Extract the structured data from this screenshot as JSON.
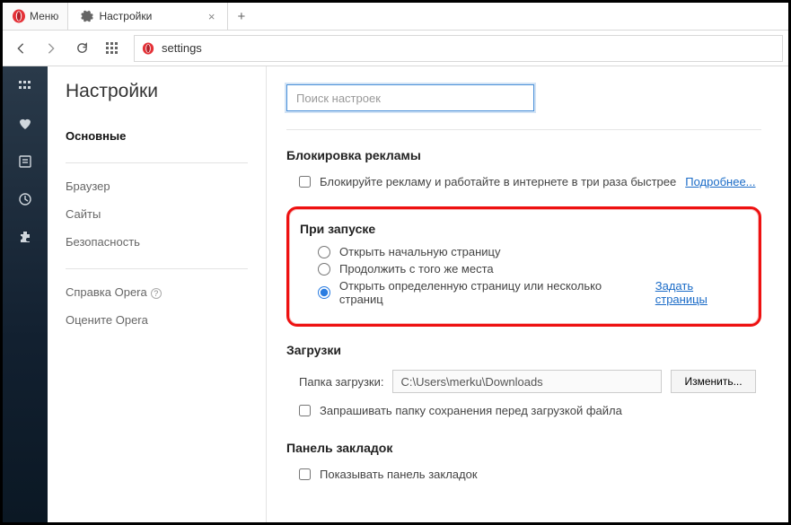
{
  "chrome": {
    "menu_label": "Меню",
    "tab_title": "Настройки",
    "address": "settings"
  },
  "sidebar": {
    "title": "Настройки",
    "items": [
      {
        "label": "Основные",
        "active": true
      },
      {
        "label": "Браузер",
        "active": false
      },
      {
        "label": "Сайты",
        "active": false
      },
      {
        "label": "Безопасность",
        "active": false
      }
    ],
    "help_label": "Справка Opera",
    "rate_label": "Оцените Opera"
  },
  "search": {
    "placeholder": "Поиск настроек"
  },
  "sections": {
    "ads": {
      "title": "Блокировка рекламы",
      "checkbox_label": "Блокируйте рекламу и работайте в интернете в три раза быстрее",
      "more_link": "Подробнее..."
    },
    "startup": {
      "title": "При запуске",
      "options": [
        {
          "label": "Открыть начальную страницу",
          "checked": false
        },
        {
          "label": "Продолжить с того же места",
          "checked": false
        },
        {
          "label": "Открыть определенную страницу или несколько страниц",
          "checked": true
        }
      ],
      "set_pages_link": "Задать страницы"
    },
    "downloads": {
      "title": "Загрузки",
      "folder_label": "Папка загрузки:",
      "folder_value": "C:\\Users\\merku\\Downloads",
      "change_button": "Изменить...",
      "ask_checkbox": "Запрашивать папку сохранения перед загрузкой файла"
    },
    "bookmarks_bar": {
      "title": "Панель закладок",
      "show_checkbox": "Показывать панель закладок"
    }
  }
}
